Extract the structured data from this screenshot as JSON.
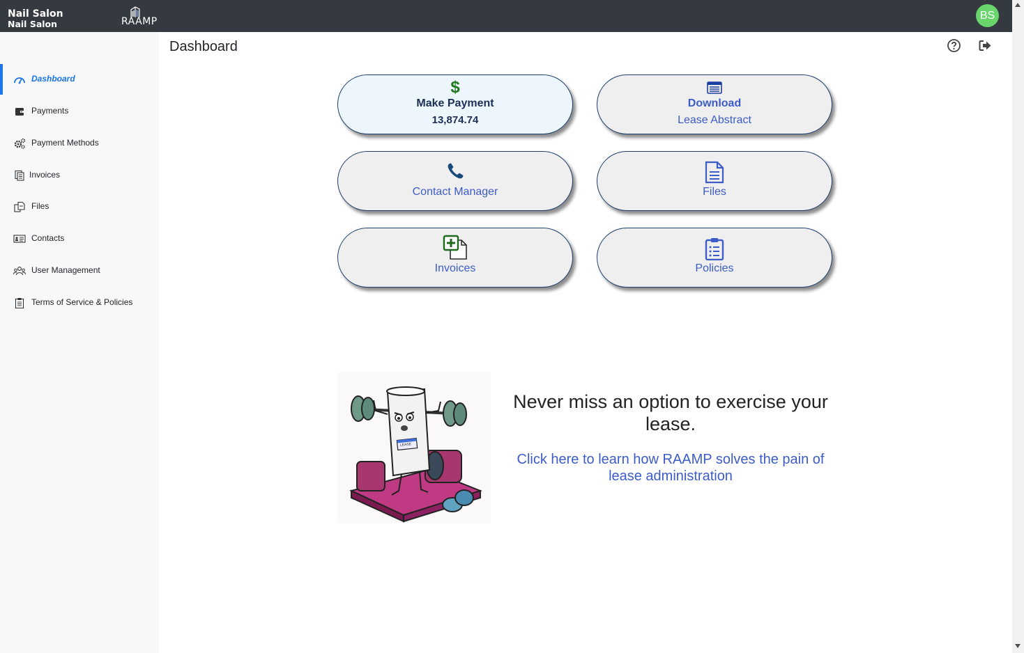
{
  "header": {
    "tenant_name": "Nail Salon",
    "tenant_subname": "Nail Salon",
    "logo_text": "RAAMP",
    "avatar_initials": "BS",
    "avatar_color": "#69d56c"
  },
  "sidebar": {
    "items": [
      {
        "label": "Dashboard",
        "icon": "gauge-icon",
        "active": true
      },
      {
        "label": "Payments",
        "icon": "wallet-icon"
      },
      {
        "label": "Payment Methods",
        "icon": "gears-icon"
      },
      {
        "label": "Invoices",
        "icon": "invoice-icon"
      },
      {
        "label": "Files",
        "icon": "files-icon"
      },
      {
        "label": "Contacts",
        "icon": "contact-card-icon"
      },
      {
        "label": "User Management",
        "icon": "users-icon"
      },
      {
        "label": "Terms of Service & Policies",
        "icon": "clipboard-icon"
      }
    ]
  },
  "main": {
    "title": "Dashboard",
    "cards": {
      "payment": {
        "line1": "Make Payment",
        "line2": "13,874.74",
        "icon": "dollar-icon"
      },
      "download": {
        "line1": "Download",
        "line2": "Lease Abstract",
        "icon": "document-list-icon"
      },
      "contact": {
        "line1": "Contact Manager",
        "icon": "phone-icon"
      },
      "files": {
        "line1": "Files",
        "icon": "file-icon"
      },
      "invoices": {
        "line1": "Invoices",
        "icon": "add-file-icon"
      },
      "policies": {
        "line1": "Policies",
        "icon": "clipboard-list-icon"
      }
    },
    "promo": {
      "headline": "Never miss an option to exercise your lease.",
      "link_text": "Click here to learn how RAAMP solves the pain of lease administration",
      "badge_text": "LEASE"
    }
  },
  "colors": {
    "topbar": "#343a40",
    "accent": "#1b74e8",
    "link": "#3d5cc8",
    "card_border": "#1a3f6b",
    "dollar_green": "#1e7a1e"
  }
}
